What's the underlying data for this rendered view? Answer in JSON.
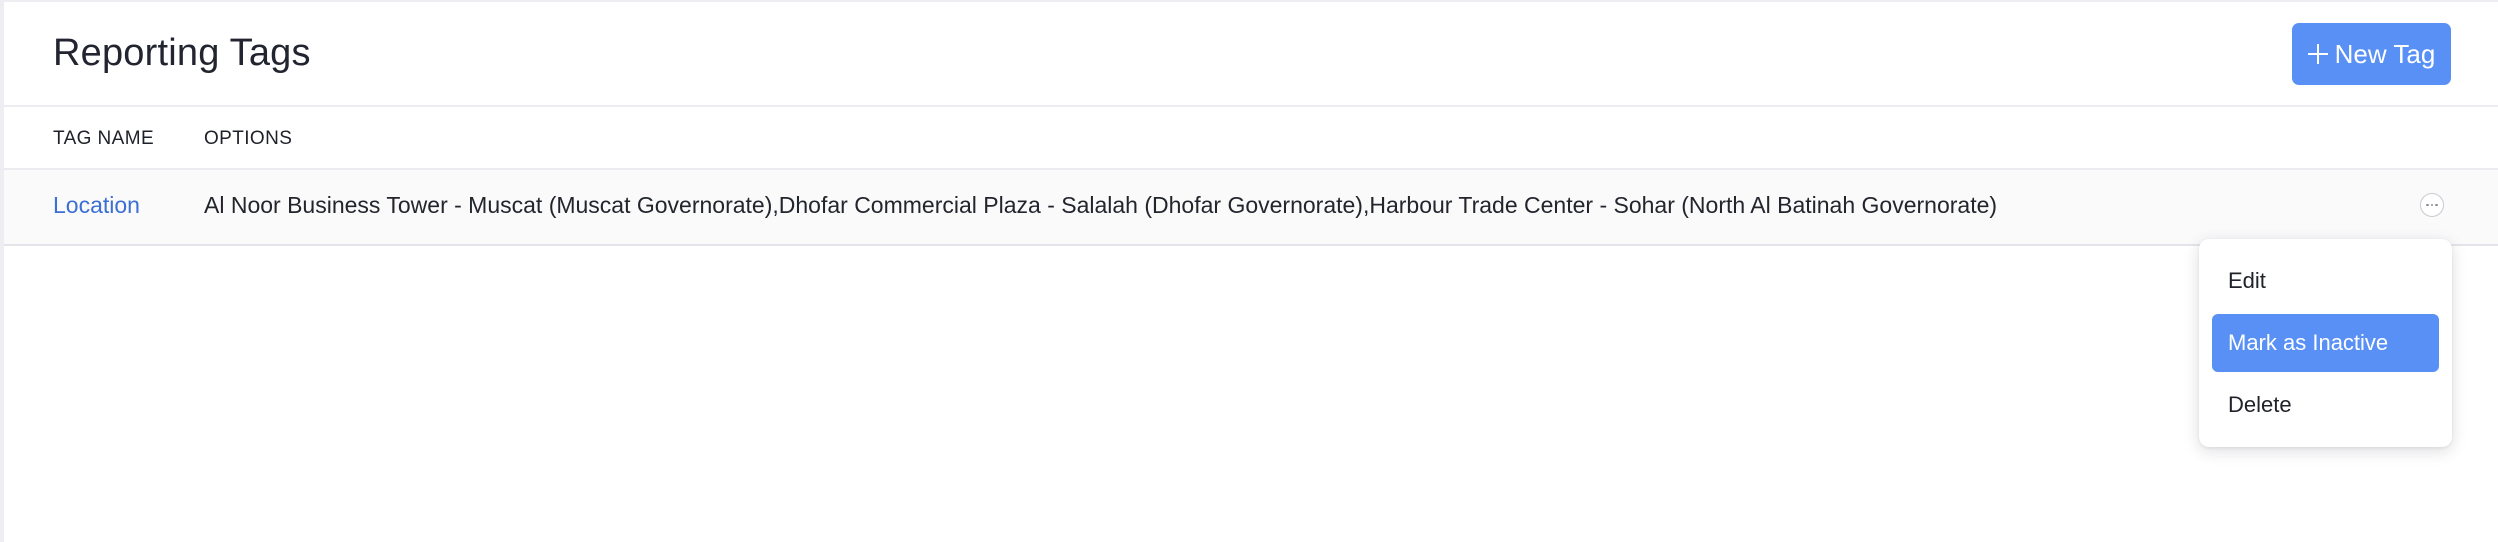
{
  "header": {
    "title": "Reporting Tags",
    "new_tag_label": "New Tag"
  },
  "table": {
    "columns": [
      "TAG NAME",
      "OPTIONS"
    ],
    "rows": [
      {
        "tag_name": "Location",
        "options": "Al Noor Business Tower - Muscat (Muscat Governorate),Dhofar Commercial Plaza - Salalah (Dhofar Governorate),Harbour Trade Center - Sohar (North Al Batinah Governorate)"
      }
    ]
  },
  "row_menu": {
    "items": [
      {
        "label": "Edit",
        "active": false
      },
      {
        "label": "Mark as Inactive",
        "active": true
      },
      {
        "label": "Delete",
        "active": false
      }
    ]
  },
  "colors": {
    "accent": "#5890f5",
    "link": "#3b6fd4"
  },
  "icons": {
    "new_tag": "plus-icon",
    "row_actions": "more-options-icon"
  }
}
